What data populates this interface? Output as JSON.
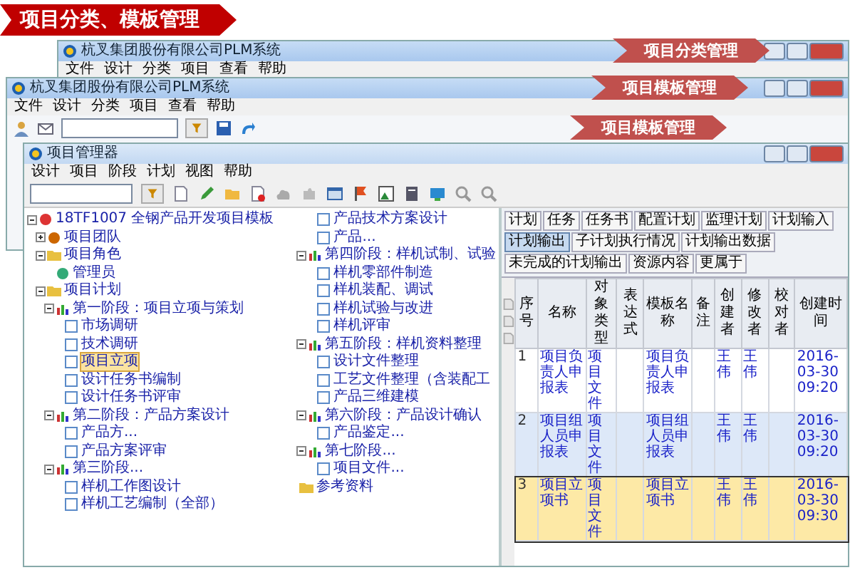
{
  "slide_title": "项目分类、模板管理",
  "windows": [
    {
      "title": "杭叉集团股份有限公司PLM系统",
      "menu": [
        "文件",
        "设计",
        "分类",
        "项目",
        "查看",
        "帮助"
      ]
    },
    {
      "title": "杭叉集团股份有限公司PLM系统",
      "menu": [
        "文件",
        "设计",
        "分类",
        "项目",
        "查看",
        "帮助"
      ]
    }
  ],
  "main": {
    "title": "项目管理器",
    "menu": [
      "设计",
      "项目",
      "阶段",
      "计划",
      "视图",
      "帮助"
    ],
    "tree": [
      {
        "label": "18TF1007 全钢产品开发项目模板",
        "kind": "project",
        "selected": false,
        "expanded": true,
        "children": [
          {
            "label": "项目团队",
            "kind": "team",
            "selected": false,
            "expanded": false
          },
          {
            "label": "项目角色",
            "kind": "folder",
            "selected": false,
            "expanded": true,
            "children": [
              {
                "label": "管理员",
                "kind": "user",
                "selected": false
              }
            ]
          },
          {
            "label": "项目计划",
            "kind": "plan",
            "selected": false,
            "expanded": true,
            "children": [
              {
                "label": "第一阶段：项目立项与策划",
                "kind": "stage",
                "selected": false,
                "expanded": true,
                "children": [
                  {
                    "label": "市场调研",
                    "kind": "task",
                    "selected": false
                  },
                  {
                    "label": "技术调研",
                    "kind": "task",
                    "selected": false
                  },
                  {
                    "label": "项目立项",
                    "kind": "task",
                    "selected": true
                  },
                  {
                    "label": "设计任务书编制",
                    "kind": "task",
                    "selected": false
                  },
                  {
                    "label": "设计任务书评审",
                    "kind": "task",
                    "selected": false
                  }
                ]
              },
              {
                "label": "第二阶段：产品方案设计",
                "kind": "stage",
                "selected": false,
                "expanded": true,
                "children": [
                  {
                    "label": "产品方...",
                    "kind": "task",
                    "selected": false
                  },
                  {
                    "label": "产品方案评审",
                    "kind": "task",
                    "selected": false
                  }
                ]
              },
              {
                "label": "第三阶段...",
                "kind": "stage",
                "selected": false,
                "expanded": true,
                "children": [
                  {
                    "label": "样机工作图设计",
                    "kind": "task",
                    "selected": false
                  },
                  {
                    "label": "样机工艺编制（全部）",
                    "kind": "task",
                    "selected": false
                  },
                  {
                    "label": "产品技术方案设计",
                    "kind": "task",
                    "selected": false
                  },
                  {
                    "label": "产品...",
                    "kind": "task",
                    "selected": false
                  }
                ]
              },
              {
                "label": "第四阶段：样机试制、试验",
                "kind": "stage",
                "selected": false,
                "expanded": true,
                "children": [
                  {
                    "label": "样机零部件制造",
                    "kind": "task",
                    "selected": false
                  },
                  {
                    "label": "样机装配、调试",
                    "kind": "task",
                    "selected": false
                  },
                  {
                    "label": "样机试验与改进",
                    "kind": "task",
                    "selected": false
                  },
                  {
                    "label": "样机评审",
                    "kind": "task",
                    "selected": false
                  }
                ]
              },
              {
                "label": "第五阶段：样机资料整理",
                "kind": "stage",
                "selected": false,
                "expanded": true,
                "children": [
                  {
                    "label": "设计文件整理",
                    "kind": "task",
                    "selected": false
                  },
                  {
                    "label": "工艺文件整理（含装配工",
                    "kind": "task",
                    "selected": false
                  },
                  {
                    "label": "产品三维建模",
                    "kind": "task",
                    "selected": false
                  }
                ]
              },
              {
                "label": "第六阶段：产品设计确认",
                "kind": "stage",
                "selected": false,
                "expanded": true,
                "children": [
                  {
                    "label": "产品鉴定...",
                    "kind": "task",
                    "selected": false
                  }
                ]
              },
              {
                "label": "第七阶段...",
                "kind": "stage",
                "selected": false,
                "expanded": true,
                "children": [
                  {
                    "label": "项目文件...",
                    "kind": "task",
                    "selected": false
                  }
                ]
              }
            ]
          },
          {
            "label": "参考资料",
            "kind": "folder",
            "selected": false
          }
        ]
      }
    ],
    "tabs": [
      {
        "label": "计划",
        "selected": false
      },
      {
        "label": "任务",
        "selected": false
      },
      {
        "label": "任务书",
        "selected": false
      },
      {
        "label": "配置计划",
        "selected": false
      },
      {
        "label": "监理计划",
        "selected": false
      },
      {
        "label": "计划输入",
        "selected": false
      },
      {
        "label": "计划输出",
        "selected": true
      },
      {
        "label": "子计划执行情况",
        "selected": false
      },
      {
        "label": "计划输出数据",
        "selected": false
      },
      {
        "label": "未完成的计划输出",
        "selected": false
      },
      {
        "label": "资源内容",
        "selected": false
      },
      {
        "label": "更属于",
        "selected": false
      }
    ],
    "table": {
      "columns": [
        "序号",
        "名称",
        "对象类型",
        "表达式",
        "模板名称",
        "备注",
        "创建者",
        "修改者",
        "校对者",
        "创建时间"
      ],
      "rows": [
        {
          "selected": false,
          "cells": [
            "1",
            "项目负责人申报表",
            "项目文件",
            "",
            "项目负责人申报表",
            "",
            "王伟",
            "王伟",
            "",
            "2016-03-30 09:20"
          ]
        },
        {
          "selected": false,
          "cells": [
            "2",
            "项目组人员申报表",
            "项目文件",
            "",
            "项目组人员申报表",
            "",
            "王伟",
            "王伟",
            "",
            "2016-03-30 09:20"
          ]
        },
        {
          "selected": true,
          "cells": [
            "3",
            "项目立项书",
            "项目文件",
            "",
            "项目立项书",
            "",
            "王伟",
            "王伟",
            "",
            "2016-03-30 09:30"
          ]
        }
      ]
    }
  },
  "callouts": [
    "项目分类管理",
    "项目模板管理",
    "项目模板管理"
  ]
}
